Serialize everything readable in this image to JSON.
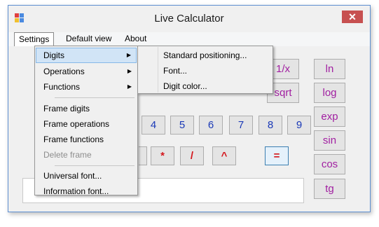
{
  "window": {
    "title": "Live Calculator",
    "close_symbol": "✕"
  },
  "menubar": {
    "items": [
      "Settings",
      "Default view",
      "About"
    ]
  },
  "settings_menu": {
    "items": [
      {
        "label": "Digits",
        "arrow": "▶"
      },
      {
        "label": "Operations",
        "arrow": "▶"
      },
      {
        "label": "Functions",
        "arrow": "▶"
      },
      {
        "label": "Frame digits"
      },
      {
        "label": "Frame operations"
      },
      {
        "label": "Frame functions"
      },
      {
        "label": "Delete frame"
      },
      {
        "label": "Universal font..."
      },
      {
        "label": "Information font..."
      }
    ]
  },
  "digits_submenu": {
    "items": [
      "Standard positioning...",
      "Font...",
      "Digit color..."
    ]
  },
  "keypad": {
    "digits": [
      "4",
      "5",
      "6",
      "7",
      "8",
      "9"
    ],
    "operators": [
      "*",
      "/",
      "^"
    ],
    "equals": "=",
    "top_row": [
      "1/x",
      "sqrt"
    ]
  },
  "functions": [
    "ln",
    "log",
    "exp",
    "sin",
    "cos",
    "tg"
  ],
  "colors": {
    "digit": "#1a39b7",
    "operator": "#d4151b",
    "function": "#a11fa1",
    "highlight": "#d1e4f6"
  }
}
